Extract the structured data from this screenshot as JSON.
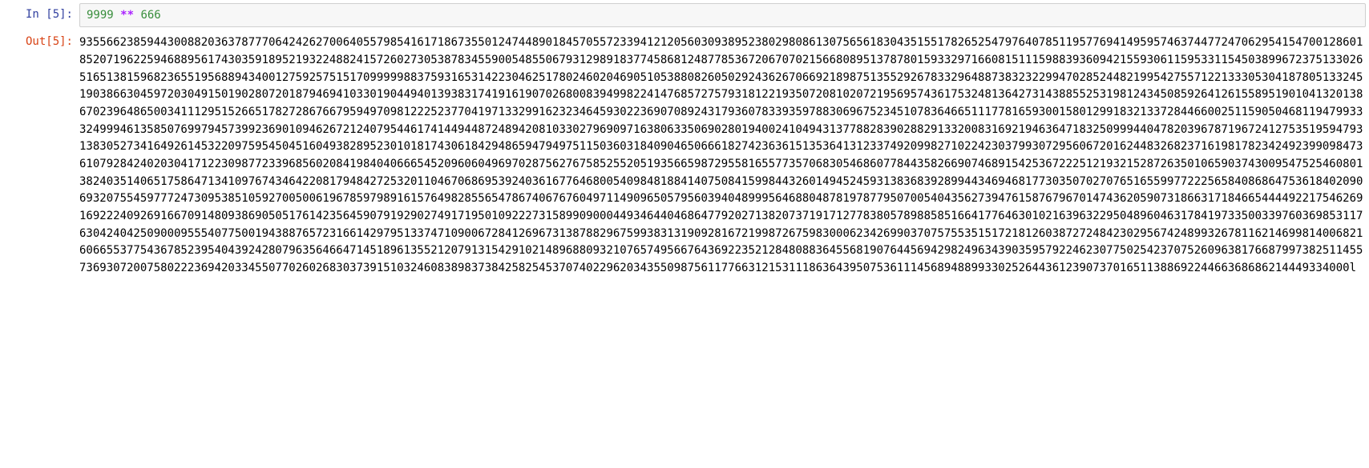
{
  "input_cell": {
    "prompt": "In  [5]:",
    "code": {
      "num1": "9999",
      "op": "**",
      "num2": "666"
    }
  },
  "output_cell": {
    "prompt": "Out[5]:",
    "text": "935566238594430088203637877706424262700640557985416171867355012474489018457055723394121205603093895238029808613075656183043515517826525479764078511957769414959574637447724706295415470012860185207196225946889561743035918952193224882415726027305387834559005485506793129891837745868124877853672067070215668089513787801593329716608151115988393609421559306115953311545038996723751330265165138159682365519568894340012759257515170999998837593165314223046251780246020469051053880826050292436267066921898751355292678332964887383232299470285244821995427557122133305304187805133245190386630459720304915019028072018794694103301904494013938317419161907026800839499822414768572757931812219350720810207219569574361753248136427314388552531981243450859264126155895190104132013867023964865003411129515266517827286766795949709812225237704197133299162323464593022369070892431793607833935978830696752345107836466511177816593001580129918321337284466002511590504681194799333249994613585076997945739923690109462672124079544617414494487248942081033027969097163806335069028019400241049431377882839028829133200831692194636471832509994404782039678719672412753519594793138305273416492614532209759545045160493828952301018174306184294865947949751150360318409046506661827423636151353641312337492099827102242303799307295606720162448326823716198178234249239909847361079284240203041712230987723396856020841984040666545209606049697028756276758525520519356659872955816557735706830546860778443582669074689154253672225121932152872635010659037430095475254608013824035140651758647134109767434642208179484272532011046706869539240361677646800540984818841407508415998443260149452459313836839289944346946817730350702707651655997722256584086864753618402090693207554597772473095385105927005006196785979891615764982855654786740676760497114909650579560394048999564688048781978779507005404356273947615876796701474362059073186631718466544449221754626916922240926916670914809386905051761423564590791929027491719501092227315899090004493464404686477920271382073719171277838057898858516641776463010216396322950489604631784197335003397603698531176304240425090009555407750019438876572316614297951337471090067284126967313878829675993831319092816721998726759830006234269903707575535151721812603872724842302956742489932678116214699814006821606655377543678523954043924280796356466471451896135521207913154291021489688093210765749566764369223521284808836455681907644569429824963439035957922462307750254237075260963817668799738251145573693072007580222369420334550770260268303739151032460838983738425825453707402296203435509875611776631215311186364395075361114568948899330252644361239073701651138869224466368686214449334000l"
  }
}
